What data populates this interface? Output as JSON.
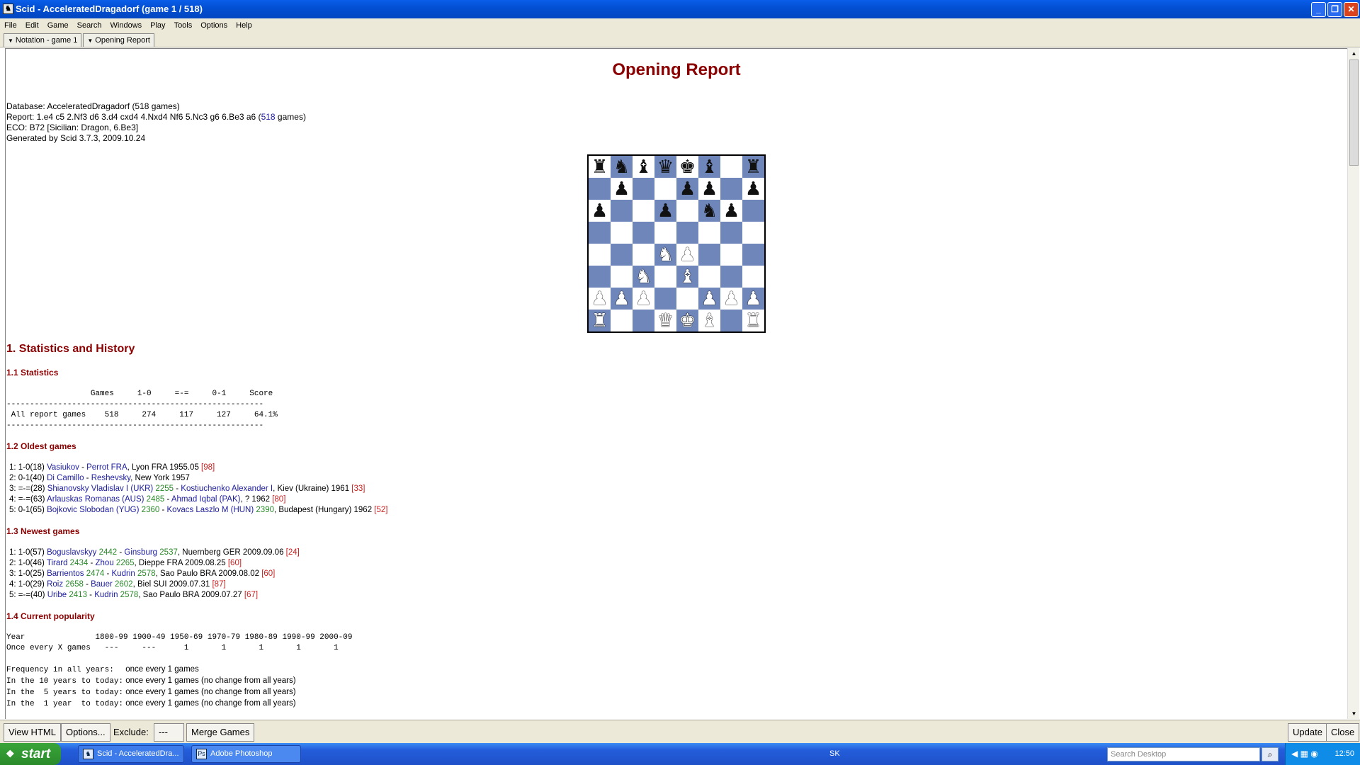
{
  "window": {
    "title": "Scid - AcceleratedDragadorf (game 1 / 518)",
    "app_icon": "scid-icon"
  },
  "menu": [
    "File",
    "Edit",
    "Game",
    "Search",
    "Windows",
    "Play",
    "Tools",
    "Options",
    "Help"
  ],
  "tabs": [
    "Notation - game 1",
    "Opening Report"
  ],
  "report": {
    "title": "Opening Report",
    "info": {
      "database": "Database: AcceleratedDragadorf (518 games)",
      "report_prefix": "Report:  1.e4 c5 2.Nf3 d6 3.d4 cxd4 4.Nxd4 Nf6 5.Nc3 g6 6.Be3 a6 (",
      "report_games": "518",
      "report_suffix": " games)",
      "eco": "ECO: B72 [Sicilian: Dragon, 6.Be3]",
      "generated": "Generated by Scid 3.7.3, 2009.10.24"
    },
    "board": [
      [
        "br",
        "bn",
        "bb",
        "bq",
        "bk",
        "bb",
        "",
        "br"
      ],
      [
        "",
        "bp",
        "",
        "",
        "bp",
        "bp",
        "",
        "bp"
      ],
      [
        "bp",
        "",
        "",
        "bp",
        "",
        "bn",
        "bp",
        ""
      ],
      [
        "",
        "",
        "",
        "",
        "",
        "",
        "",
        ""
      ],
      [
        "",
        "",
        "",
        "wn",
        "wp",
        "",
        "",
        ""
      ],
      [
        "",
        "",
        "wn",
        "",
        "wb",
        "",
        "",
        ""
      ],
      [
        "wp",
        "wp",
        "wp",
        "",
        "",
        "wp",
        "wp",
        "wp"
      ],
      [
        "wr",
        "",
        "",
        "wq",
        "wk",
        "wb",
        "",
        "wr"
      ]
    ],
    "section1": "1. Statistics and History",
    "stats": {
      "heading": "1.1 Statistics",
      "header": "                  Games     1-0     =-=     0-1     Score",
      "rule": "-------------------------------------------------------",
      "row": " All report games    518     274     117     127     64.1%"
    },
    "oldest": {
      "heading": "1.2 Oldest games",
      "games": [
        {
          "num": "1:",
          "res": "1-0(18)",
          "white": "Vasiukov",
          "welo": "",
          "black": "Perrot FRA",
          "belo": "",
          "place": ", Lyon FRA 1955.05 ",
          "ply": "[98]"
        },
        {
          "num": "2:",
          "res": "0-1(40)",
          "white": "Di Camillo",
          "welo": "",
          "black": "Reshevsky",
          "belo": "",
          "place": ", New York 1957",
          "ply": ""
        },
        {
          "num": "3:",
          "res": "=-=(28)",
          "white": "Shianovsky Vladislav I (UKR)",
          "welo": "2255",
          "black": "Kostiuchenko Alexander I",
          "belo": "",
          "place": ", Kiev (Ukraine) 1961 ",
          "ply": "[33]"
        },
        {
          "num": "4:",
          "res": "=-=(63)",
          "white": "Arlauskas Romanas (AUS)",
          "welo": "2485",
          "black": "Ahmad Iqbal (PAK)",
          "belo": "",
          "place": ", ? 1962 ",
          "ply": "[80]"
        },
        {
          "num": "5:",
          "res": "0-1(65)",
          "white": "Bojkovic Slobodan (YUG)",
          "welo": "2360",
          "black": "Kovacs Laszlo M (HUN)",
          "belo": "2390",
          "place": ", Budapest (Hungary) 1962 ",
          "ply": "[52]"
        }
      ]
    },
    "newest": {
      "heading": "1.3 Newest games",
      "games": [
        {
          "num": "1:",
          "res": "1-0(57)",
          "white": "Boguslavskyy",
          "welo": "2442",
          "black": "Ginsburg",
          "belo": "2537",
          "place": ", Nuernberg GER 2009.09.06 ",
          "ply": "[24]"
        },
        {
          "num": "2:",
          "res": "1-0(46)",
          "white": "Tirard",
          "welo": "2434",
          "black": "Zhou",
          "belo": "2265",
          "place": ", Dieppe FRA 2009.08.25 ",
          "ply": "[60]"
        },
        {
          "num": "3:",
          "res": "1-0(25)",
          "white": "Barrientos",
          "welo": "2474",
          "black": "Kudrin",
          "belo": "2578",
          "place": ", Sao Paulo BRA 2009.08.02 ",
          "ply": "[60]"
        },
        {
          "num": "4:",
          "res": "1-0(29)",
          "white": "Roiz",
          "welo": "2658",
          "black": "Bauer",
          "belo": "2602",
          "place": ", Biel SUI 2009.07.31 ",
          "ply": "[87]"
        },
        {
          "num": "5:",
          "res": "=-=(40)",
          "white": "Uribe",
          "welo": "2413",
          "black": "Kudrin",
          "belo": "2578",
          "place": ", Sao Paulo BRA 2009.07.27 ",
          "ply": "[67]"
        }
      ]
    },
    "popularity": {
      "heading": "1.4 Current popularity",
      "table": "Year               1800-99 1900-49 1950-69 1970-79 1980-89 1990-99 2000-09\nOnce every X games   ---     ---      1       1       1       1       1",
      "freq": [
        {
          "label": "Frequency in all years:  ",
          "text": "once every 1 games"
        },
        {
          "label": "In the 10 years to today:",
          "text": "once every 1 games (no change from all years)"
        },
        {
          "label": "In the  5 years to today:",
          "text": "once every 1 games (no change from all years)"
        },
        {
          "label": "In the  1 year  to today:",
          "text": "once every 1 games (no change from all years)"
        }
      ]
    }
  },
  "bottom": {
    "view_html": "View HTML",
    "options": "Options...",
    "exclude_label": "Exclude:",
    "exclude_value": "---",
    "merge": "Merge Games",
    "update": "Update",
    "close": "Close"
  },
  "taskbar": {
    "start": "start",
    "tasks": [
      "Scid - AcceleratedDra...",
      "Adobe Photoshop"
    ],
    "lang": "SK",
    "search_placeholder": "Search Desktop",
    "clock": "12:50"
  }
}
